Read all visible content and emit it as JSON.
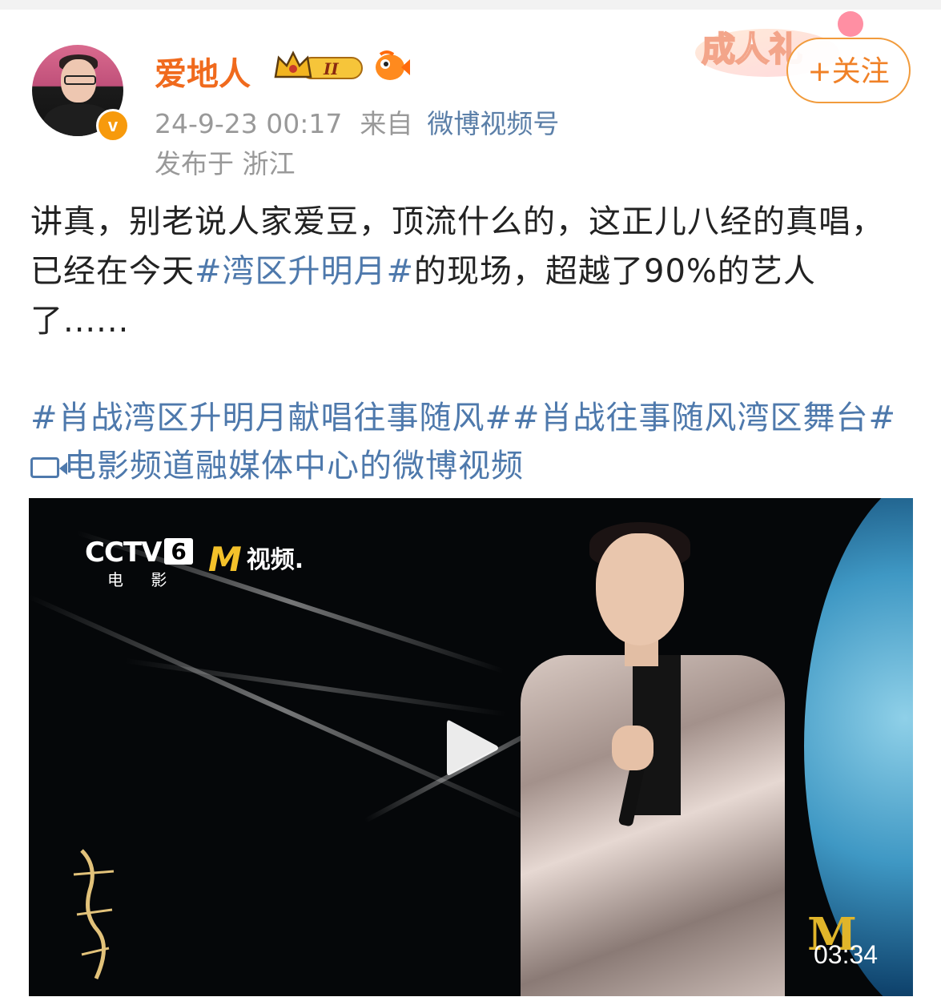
{
  "post": {
    "username": "爱地人",
    "level_badge": "II",
    "avatar_badge": "v",
    "timestamp": "24-9-23 00:17",
    "from_label": "来自",
    "source": "微博视频号",
    "location": "发布于 浙江",
    "follow_label": "+关注",
    "decoration_text": "成人礼",
    "text_part1": "讲真，别老说人家爱豆，顶流什么的，这正儿八经的真唱，已经在今天",
    "text_tag": "#湾区升明月#",
    "text_part2": "的现场，超越了90%的艺人了......",
    "tag_line1": "#肖战湾区升明月献唱往事随风##肖战往事随风湾区舞台#",
    "tag_line2": "电影频道融媒体中心的微博视频"
  },
  "video": {
    "channel_logo": "CCTV",
    "channel_number": "6",
    "channel_sub": "电 影",
    "m_logo_text": "视频.",
    "corner_logo": "M",
    "duration": "03:34"
  },
  "colors": {
    "username": "#f06a1d",
    "link": "#4e79ac",
    "follow": "#f08127",
    "meta": "#999999"
  }
}
